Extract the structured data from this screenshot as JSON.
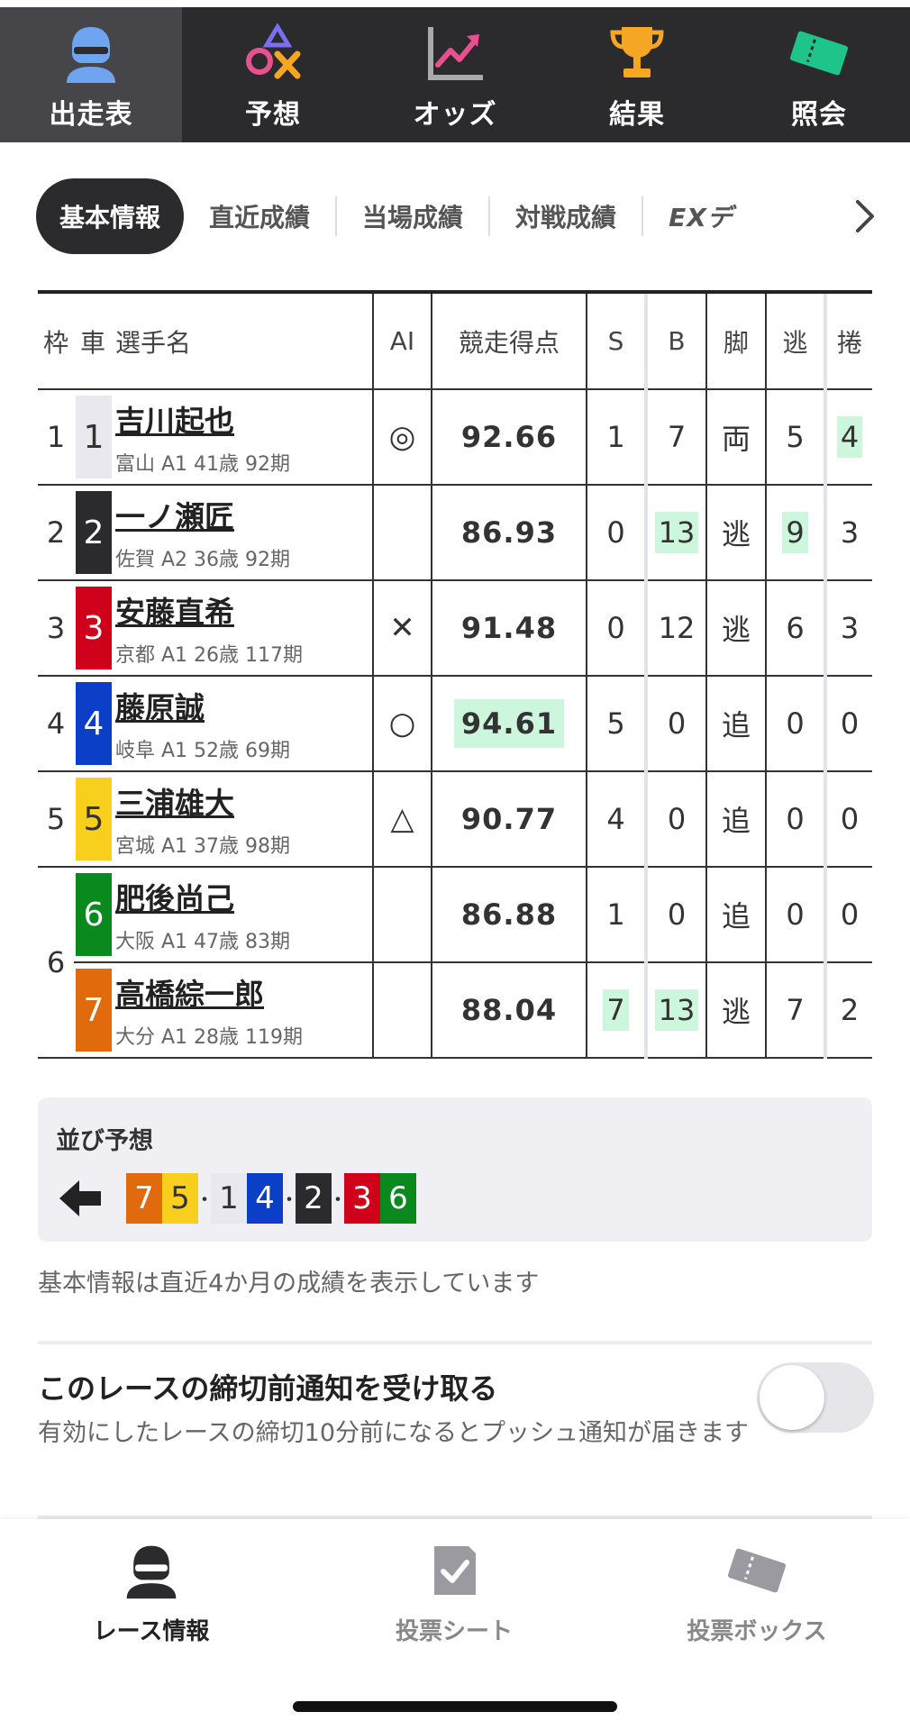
{
  "topnav": {
    "items": [
      {
        "label": "出走表",
        "icon": "rider-icon",
        "active": true
      },
      {
        "label": "予想",
        "icon": "shapes-icon",
        "active": false
      },
      {
        "label": "オッズ",
        "icon": "chart-up-icon",
        "active": false
      },
      {
        "label": "結果",
        "icon": "trophy-icon",
        "active": false
      },
      {
        "label": "照会",
        "icon": "ticket-icon",
        "active": false
      }
    ]
  },
  "tabs": {
    "items": [
      "基本情報",
      "直近成績",
      "当場成績",
      "対戦成績",
      "EXデ"
    ],
    "active": "基本情報"
  },
  "table": {
    "headers": {
      "waku": "枠",
      "sha": "車",
      "name": "選手名",
      "ai": "AI",
      "score": "競走得点",
      "s": "S",
      "b": "B",
      "kyaku": "脚",
      "nige": "逃",
      "makuri": "捲"
    },
    "rows": [
      {
        "waku": "1",
        "sha": "1",
        "sha_bg": "#e8e8ee",
        "sha_fg": "#333333",
        "name": "吉川起也",
        "info": "富山 A1 41歳 92期",
        "ai": "◎",
        "score": "92.66",
        "s": "1",
        "b": "7",
        "kyaku": "両",
        "nige": "5",
        "makuri": "4"
      },
      {
        "waku": "2",
        "sha": "2",
        "sha_bg": "#2b2b2e",
        "sha_fg": "#ffffff",
        "name": "一ノ瀬匠",
        "info": "佐賀 A2 36歳 92期",
        "ai": "",
        "score": "86.93",
        "s": "0",
        "b": "13",
        "kyaku": "逃",
        "nige": "9",
        "makuri": "3"
      },
      {
        "waku": "3",
        "sha": "3",
        "sha_bg": "#d0021b",
        "sha_fg": "#ffffff",
        "name": "安藤直希",
        "info": "京都 A1 26歳 117期",
        "ai": "✕",
        "score": "91.48",
        "s": "0",
        "b": "12",
        "kyaku": "逃",
        "nige": "6",
        "makuri": "3"
      },
      {
        "waku": "4",
        "sha": "4",
        "sha_bg": "#0b3fc8",
        "sha_fg": "#ffffff",
        "name": "藤原誠",
        "info": "岐阜 A1 52歳 69期",
        "ai": "○",
        "score": "94.61",
        "s": "5",
        "b": "0",
        "kyaku": "追",
        "nige": "0",
        "makuri": "0"
      },
      {
        "waku": "5",
        "sha": "5",
        "sha_bg": "#f8cf1c",
        "sha_fg": "#333333",
        "name": "三浦雄大",
        "info": "宮城 A1 37歳 98期",
        "ai": "△",
        "score": "90.77",
        "s": "4",
        "b": "0",
        "kyaku": "追",
        "nige": "0",
        "makuri": "0"
      },
      {
        "waku": "6",
        "sha": "6",
        "sha_bg": "#0a8a1e",
        "sha_fg": "#ffffff",
        "name": "肥後尚己",
        "info": "大阪 A1 47歳 83期",
        "ai": "",
        "score": "86.88",
        "s": "1",
        "b": "0",
        "kyaku": "追",
        "nige": "0",
        "makuri": "0"
      },
      {
        "waku": "",
        "sha": "7",
        "sha_bg": "#e06a0c",
        "sha_fg": "#ffffff",
        "name": "高橋綜一郎",
        "info": "大分 A1 28歳 119期",
        "ai": "",
        "score": "88.04",
        "s": "7",
        "b": "13",
        "kyaku": "逃",
        "nige": "7",
        "makuri": "2"
      }
    ],
    "highlight_color": "#cdf7dd"
  },
  "narabi": {
    "title": "並び予想",
    "sequence": [
      "7",
      "5",
      "・",
      "1",
      "4",
      "・",
      "2",
      "・",
      "3",
      "6"
    ]
  },
  "note": "基本情報は直近4か月の成績を表示しています",
  "notify": {
    "title": "このレースの締切前通知を受け取る",
    "desc": "有効にしたレースの締切10分前になるとプッシュ通知が届きます",
    "enabled": false
  },
  "bottomnav": {
    "items": [
      {
        "label": "レース情報",
        "icon": "rider-icon",
        "active": true
      },
      {
        "label": "投票シート",
        "icon": "check-sheet-icon",
        "active": false
      },
      {
        "label": "投票ボックス",
        "icon": "ticket-icon",
        "active": false
      }
    ]
  }
}
